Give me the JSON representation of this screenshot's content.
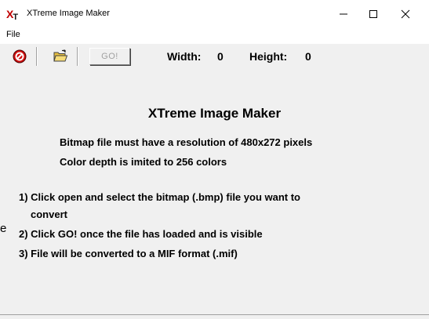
{
  "window": {
    "title": "XTreme Image Maker",
    "logo": {
      "main": "X",
      "sub": "T"
    }
  },
  "menu": {
    "file": "File"
  },
  "toolbar": {
    "go_label": "GO!",
    "width_label": "Width:",
    "width_value": "0",
    "height_label": "Height:",
    "height_value": "0",
    "icons": [
      "stop-icon",
      "open-folder-icon"
    ]
  },
  "content": {
    "heading": "XTreme Image Maker",
    "info": [
      "Bitmap file must have a resolution of 480x272 pixels",
      "Color depth is imited to 256 colors"
    ],
    "steps": [
      "1) Click open and select the bitmap (.bmp) file you want to",
      "convert",
      "2) Click GO! once the file has loaded and is visible",
      "3) File will be converted to a MIF format (.mif)"
    ],
    "stray_char": "e"
  },
  "colors": {
    "panel": "#f0f0f0",
    "logo_red": "#c00000",
    "stop_red": "#d01010",
    "folder_yellow": "#e8c040",
    "disabled_text": "#a0a0a0"
  }
}
